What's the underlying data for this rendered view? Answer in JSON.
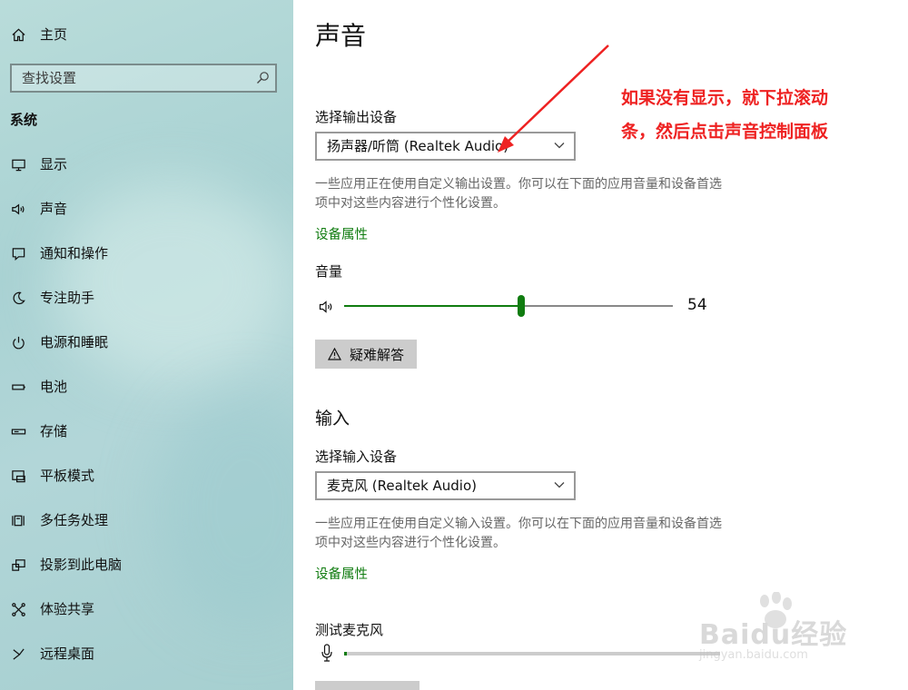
{
  "sidebar": {
    "home_label": "主页",
    "search_placeholder": "查找设置",
    "section_title": "系统",
    "items": [
      {
        "label": "显示",
        "icon": "monitor-icon"
      },
      {
        "label": "声音",
        "icon": "speaker-icon"
      },
      {
        "label": "通知和操作",
        "icon": "notification-icon"
      },
      {
        "label": "专注助手",
        "icon": "moon-icon"
      },
      {
        "label": "电源和睡眠",
        "icon": "power-icon"
      },
      {
        "label": "电池",
        "icon": "battery-icon"
      },
      {
        "label": "存储",
        "icon": "storage-icon"
      },
      {
        "label": "平板模式",
        "icon": "tablet-mode-icon"
      },
      {
        "label": "多任务处理",
        "icon": "multitasking-icon"
      },
      {
        "label": "投影到此电脑",
        "icon": "projecting-icon"
      },
      {
        "label": "体验共享",
        "icon": "shared-experiences-icon"
      },
      {
        "label": "远程桌面",
        "icon": "remote-desktop-icon"
      }
    ]
  },
  "main": {
    "title": "声音",
    "output": {
      "label": "选择输出设备",
      "selected": "扬声器/听筒 (Realtek Audio)",
      "desc": "一些应用正在使用自定义输出设置。你可以在下面的应用音量和设备首选项中对这些内容进行个性化设置。",
      "device_properties": "设备属性",
      "volume_label": "音量",
      "volume": 54,
      "volume_text": "54",
      "troubleshoot": "疑难解答"
    },
    "input": {
      "heading": "输入",
      "label": "选择输入设备",
      "selected": "麦克风 (Realtek Audio)",
      "desc": "一些应用正在使用自定义输入设置。你可以在下面的应用音量和设备首选项中对这些内容进行个性化设置。",
      "device_properties": "设备属性",
      "test_mic": "测试麦克风"
    }
  },
  "annotation": {
    "line1": "如果没有显示，就下拉滚动",
    "line2": "条，然后点击声音控制面板",
    "color": "#ee2222"
  },
  "watermark": {
    "brand": "Baidu经验",
    "url": "jingyan.baidu.com"
  },
  "colors": {
    "accent": "#107c10",
    "sidebar_bg": "#b2d6d8"
  }
}
